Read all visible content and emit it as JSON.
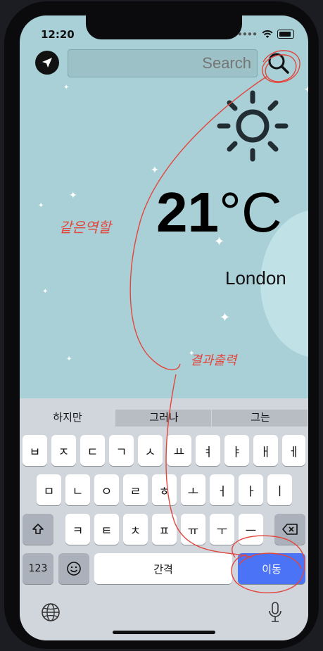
{
  "status_bar": {
    "time": "12:20"
  },
  "search": {
    "placeholder": "Search"
  },
  "weather": {
    "temp_value": "21",
    "temp_unit": "°C",
    "city": "London"
  },
  "keyboard": {
    "suggestions": [
      "하지만",
      "그러나",
      "그는"
    ],
    "row1": [
      "ㅂ",
      "ㅈ",
      "ㄷ",
      "ㄱ",
      "ㅅ",
      "ㅛ",
      "ㅕ",
      "ㅑ",
      "ㅐ",
      "ㅔ"
    ],
    "row2": [
      "ㅁ",
      "ㄴ",
      "ㅇ",
      "ㄹ",
      "ㅎ",
      "ㅗ",
      "ㅓ",
      "ㅏ",
      "ㅣ"
    ],
    "row3": [
      "ㅋ",
      "ㅌ",
      "ㅊ",
      "ㅍ",
      "ㅠ",
      "ㅜ",
      "ㅡ"
    ],
    "numbers_label": "123",
    "space_label": "간격",
    "go_label": "이동"
  },
  "annotations": {
    "note_left": "같은역할",
    "note_bottom": "결과출력"
  },
  "colors": {
    "sky": "#a9d0d6",
    "moon": "#c0e1e5",
    "go_key": "#4b73f6",
    "annotation": "#e2463d"
  }
}
